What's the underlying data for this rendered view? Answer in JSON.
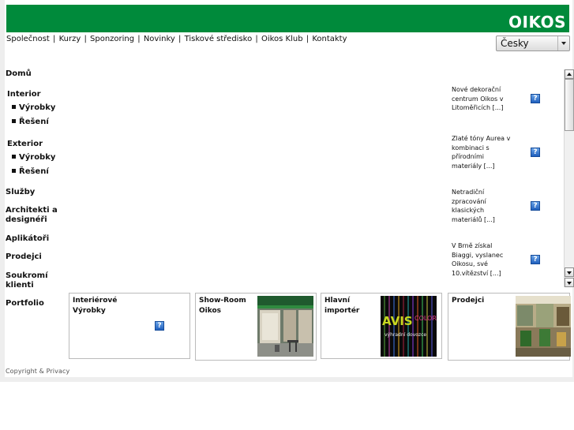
{
  "brand": {
    "logo_text": "OIKOS",
    "header_color": "#008a3b"
  },
  "topnav": {
    "items": [
      "Společnost",
      "Kurzy",
      "Sponzoring",
      "Novinky",
      "Tiskové středisko",
      "Oikos Klub",
      "Kontakty"
    ],
    "separator": " | "
  },
  "language": {
    "selected": "Česky"
  },
  "sidebar": {
    "home": "Domů",
    "interior": {
      "label": "Interior",
      "products": "Výrobky",
      "solutions": "Řešení"
    },
    "exterior": {
      "label": "Exterior",
      "products": "Výrobky",
      "solutions": "Řešení"
    },
    "services": "Služby",
    "architects": [
      "Architekti a",
      "designéři"
    ],
    "applicators": "Aplikátoři",
    "sellers": "Prodejci",
    "private": [
      "Soukromí",
      "klienti"
    ],
    "portfolio": "Portfolio"
  },
  "news": {
    "items": [
      {
        "text": "Nové dekorační centrum Oikos v Litoměřicích [...]"
      },
      {
        "text": "Zlaté tóny Aurea v kombinaci s přírodními materiály [...]"
      },
      {
        "text": "Netradiční zpracování klasických materiálů [...]"
      },
      {
        "text": "V Brně získal Biaggi, vyslanec Oikosu, své 10.vítězství [...]"
      }
    ],
    "icon_glyph": "?"
  },
  "cards": [
    {
      "title": "Interiérové Výrobky"
    },
    {
      "title": "Show-Room Oikos"
    },
    {
      "title": "Hlavní importér",
      "image_text": "AVIS",
      "image_text2": "COLOR",
      "image_caption": "výhradní dovozce"
    },
    {
      "title": "Prodejci"
    }
  ],
  "footer": {
    "copyright": "Copyright & Privacy"
  }
}
